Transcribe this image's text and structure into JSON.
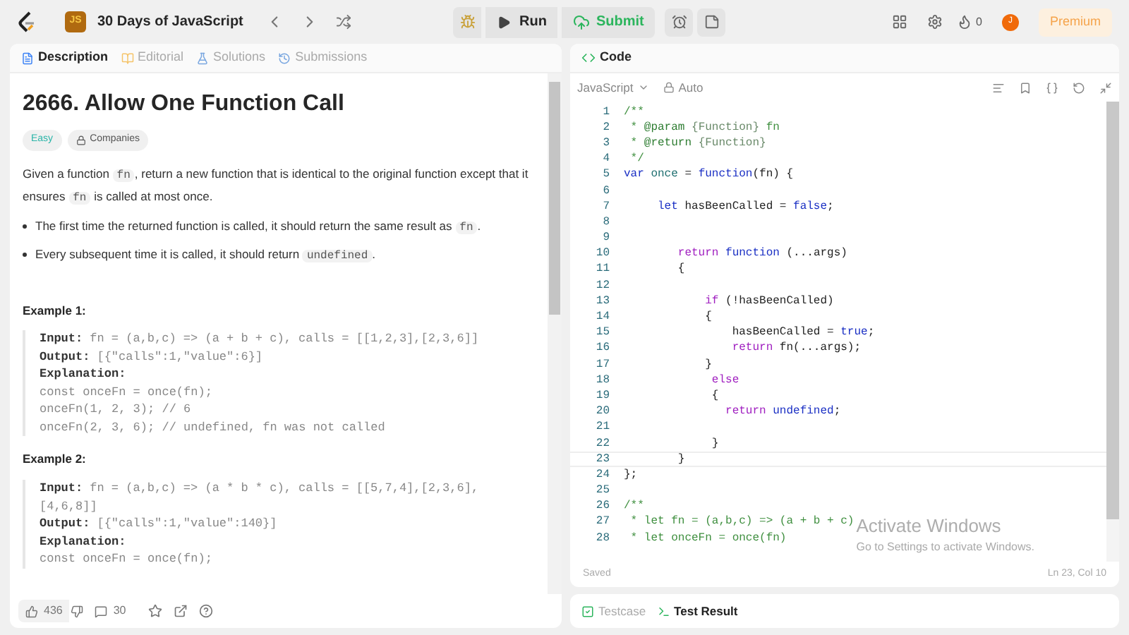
{
  "topbar": {
    "badge": "JS",
    "study_plan": "30 Days of JavaScript",
    "run": "Run",
    "submit": "Submit",
    "streak": "0",
    "avatar": "J",
    "premium": "Premium"
  },
  "description_tabs": [
    {
      "label": "Description",
      "selected": true
    },
    {
      "label": "Editorial",
      "selected": false
    },
    {
      "label": "Solutions",
      "selected": false
    },
    {
      "label": "Submissions",
      "selected": false
    }
  ],
  "problem": {
    "title": "2666. Allow One Function Call",
    "difficulty": "Easy",
    "companies": "Companies",
    "paragraph": [
      {
        "text": "Given a function ",
        "kind": "text"
      },
      {
        "text": "fn",
        "kind": "code"
      },
      {
        "text": ", return a new function that is identical to the original function except that it ensures ",
        "kind": "text"
      },
      {
        "text": "fn",
        "kind": "code"
      },
      {
        "text": " is called at most once.",
        "kind": "text"
      }
    ],
    "bullets": [
      [
        {
          "text": "The first time the returned function is called, it should return the same result as ",
          "kind": "text"
        },
        {
          "text": "fn",
          "kind": "code"
        },
        {
          "text": ".",
          "kind": "text"
        }
      ],
      [
        {
          "text": "Every subsequent time it is called, it should return ",
          "kind": "text"
        },
        {
          "text": "undefined",
          "kind": "code"
        },
        {
          "text": ".",
          "kind": "text"
        }
      ]
    ],
    "examples": [
      {
        "title": "Example 1:",
        "lines": [
          {
            "label": "Input:",
            "value": "fn = (a,b,c) => (a + b + c), calls = [[1,2,3],[2,3,6]]"
          },
          {
            "label": "Output:",
            "value": "[{\"calls\":1,\"value\":6}]"
          },
          {
            "label": "Explanation:"
          },
          {
            "value": "const onceFn = once(fn);"
          },
          {
            "value": "onceFn(1, 2, 3); // 6"
          },
          {
            "value": "onceFn(2, 3, 6); // undefined, fn was not called"
          }
        ]
      },
      {
        "title": "Example 2:",
        "lines": [
          {
            "label": "Input:",
            "value": "fn = (a,b,c) => (a * b * c), calls = [[5,7,4],[2,3,6],"
          },
          {
            "value": "[4,6,8]]"
          },
          {
            "label": "Output:",
            "value": "[{\"calls\":1,\"value\":140}]"
          },
          {
            "label": "Explanation:"
          },
          {
            "value": "const onceFn = once(fn);"
          }
        ]
      }
    ]
  },
  "footer": {
    "likes": "436",
    "comments": "30"
  },
  "code_panel": {
    "title": "Code",
    "language": "JavaScript",
    "mode": "Auto",
    "status": "Saved",
    "cursor": "Ln 23, Col 10"
  },
  "code": [
    {
      "n": "1",
      "tokens": [
        {
          "t": "/**",
          "kind": "comment"
        }
      ]
    },
    {
      "n": "2",
      "tokens": [
        {
          "t": " * ",
          "kind": "comment"
        },
        {
          "t": "@param",
          "kind": "tag"
        },
        {
          "t": " {Function}",
          "kind": "type"
        },
        {
          "t": " fn",
          "kind": "comment"
        }
      ]
    },
    {
      "n": "3",
      "tokens": [
        {
          "t": " * ",
          "kind": "comment"
        },
        {
          "t": "@return",
          "kind": "tag"
        },
        {
          "t": " {Function}",
          "kind": "type"
        }
      ]
    },
    {
      "n": "4",
      "tokens": [
        {
          "t": " */",
          "kind": "comment"
        }
      ]
    },
    {
      "n": "5",
      "tokens": [
        {
          "t": "var",
          "kind": "keyword"
        },
        {
          "t": " once",
          "kind": "ident"
        },
        {
          "t": " = ",
          "kind": "plain"
        },
        {
          "t": "function",
          "kind": "keyword"
        },
        {
          "t": "(fn) {",
          "kind": "plain"
        }
      ]
    },
    {
      "n": "6"
    },
    {
      "n": "7",
      "tokens": [
        {
          "t": "     let",
          "kind": "keyword"
        },
        {
          "t": " hasBeenCalled = ",
          "kind": "plain"
        },
        {
          "t": "false",
          "kind": "keyword"
        },
        {
          "t": ";",
          "kind": "plain"
        }
      ]
    },
    {
      "n": "8"
    },
    {
      "n": "9"
    },
    {
      "n": "10",
      "tokens": [
        {
          "t": "        return",
          "kind": "control"
        },
        {
          "t": " function",
          "kind": "keyword"
        },
        {
          "t": " (...args)",
          "kind": "plain"
        }
      ]
    },
    {
      "n": "11",
      "tokens": [
        {
          "t": "        {",
          "kind": "plain"
        }
      ]
    },
    {
      "n": "12"
    },
    {
      "n": "13",
      "tokens": [
        {
          "t": "            if",
          "kind": "control"
        },
        {
          "t": " (!hasBeenCalled)",
          "kind": "plain"
        }
      ]
    },
    {
      "n": "14",
      "tokens": [
        {
          "t": "            {",
          "kind": "plain"
        }
      ]
    },
    {
      "n": "15",
      "tokens": [
        {
          "t": "                hasBeenCalled = ",
          "kind": "plain"
        },
        {
          "t": "true",
          "kind": "keyword"
        },
        {
          "t": ";",
          "kind": "plain"
        }
      ]
    },
    {
      "n": "16",
      "tokens": [
        {
          "t": "                return",
          "kind": "control"
        },
        {
          "t": " fn(...args);",
          "kind": "plain"
        }
      ]
    },
    {
      "n": "17",
      "tokens": [
        {
          "t": "            }",
          "kind": "plain"
        }
      ]
    },
    {
      "n": "18",
      "tokens": [
        {
          "t": "             else",
          "kind": "control"
        }
      ]
    },
    {
      "n": "19",
      "tokens": [
        {
          "t": "             {",
          "kind": "plain"
        }
      ]
    },
    {
      "n": "20",
      "tokens": [
        {
          "t": "               return",
          "kind": "control"
        },
        {
          "t": " undefined",
          "kind": "keyword"
        },
        {
          "t": ";",
          "kind": "plain"
        }
      ]
    },
    {
      "n": "21"
    },
    {
      "n": "22",
      "tokens": [
        {
          "t": "             }",
          "kind": "plain"
        }
      ]
    },
    {
      "n": "23",
      "tokens": [
        {
          "t": "        }",
          "kind": "plain"
        }
      ],
      "current": true
    },
    {
      "n": "24",
      "tokens": [
        {
          "t": "};",
          "kind": "plain"
        }
      ]
    },
    {
      "n": "25"
    },
    {
      "n": "26",
      "tokens": [
        {
          "t": "/**",
          "kind": "comment"
        }
      ]
    },
    {
      "n": "27",
      "tokens": [
        {
          "t": " * let fn = (a,b,c) => (a + b + c)",
          "kind": "comment"
        }
      ]
    },
    {
      "n": "28",
      "tokens": [
        {
          "t": " * let onceFn = once(fn)",
          "kind": "comment"
        }
      ]
    }
  ],
  "bottom_tabs": [
    {
      "label": "Testcase",
      "selected": false
    },
    {
      "label": "Test Result",
      "selected": true
    }
  ],
  "os_notice": {
    "title": "Activate Windows",
    "subtitle": "Go to Settings to activate Windows."
  }
}
